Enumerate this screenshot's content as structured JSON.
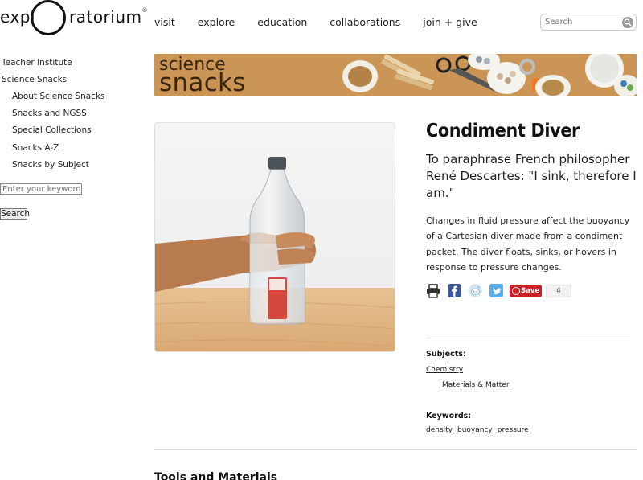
{
  "logo": {
    "part1": "expl",
    "part2": "ratorium",
    "mark": "®"
  },
  "topnav": [
    "visit",
    "explore",
    "education",
    "collaborations",
    "join + give"
  ],
  "search": {
    "placeholder": "Search"
  },
  "sidebar": {
    "items": [
      {
        "label": "Teacher Institute"
      },
      {
        "label": "Science Snacks"
      },
      {
        "label": "About Science Snacks"
      },
      {
        "label": "Snacks and NGSS"
      },
      {
        "label": "Special Collections"
      },
      {
        "label": "Snacks A-Z"
      },
      {
        "label": "Snacks by Subject"
      }
    ],
    "search_placeholder": "Enter your keywords",
    "search_button": "Search"
  },
  "banner": {
    "line1": "science",
    "line2": "snacks"
  },
  "snack": {
    "title": "Condiment Diver",
    "subtitle": "To paraphrase French philosopher René Descartes: \"I sink, therefore I am.\"",
    "description": "Changes in fluid pressure affect the buoyancy of a Cartesian diver made from a condiment packet. The diver floats, sinks, or hovers in response to pressure changes."
  },
  "share": {
    "icons": [
      "print-icon",
      "facebook-icon",
      "reddit-icon",
      "twitter-icon"
    ],
    "pinterest_label": "Save",
    "pinterest_count": "4"
  },
  "subjects": {
    "label": "Subjects:",
    "primary": "Chemistry",
    "secondary": "Materials & Matter"
  },
  "keywords": {
    "label": "Keywords:",
    "items": [
      "density",
      "buoyancy",
      "pressure"
    ]
  },
  "section": {
    "tools_heading": "Tools and Materials"
  },
  "colors": {
    "banner": "#c69252",
    "pinterest": "#cb2027",
    "facebook": "#3b5998",
    "twitter": "#55acee"
  }
}
